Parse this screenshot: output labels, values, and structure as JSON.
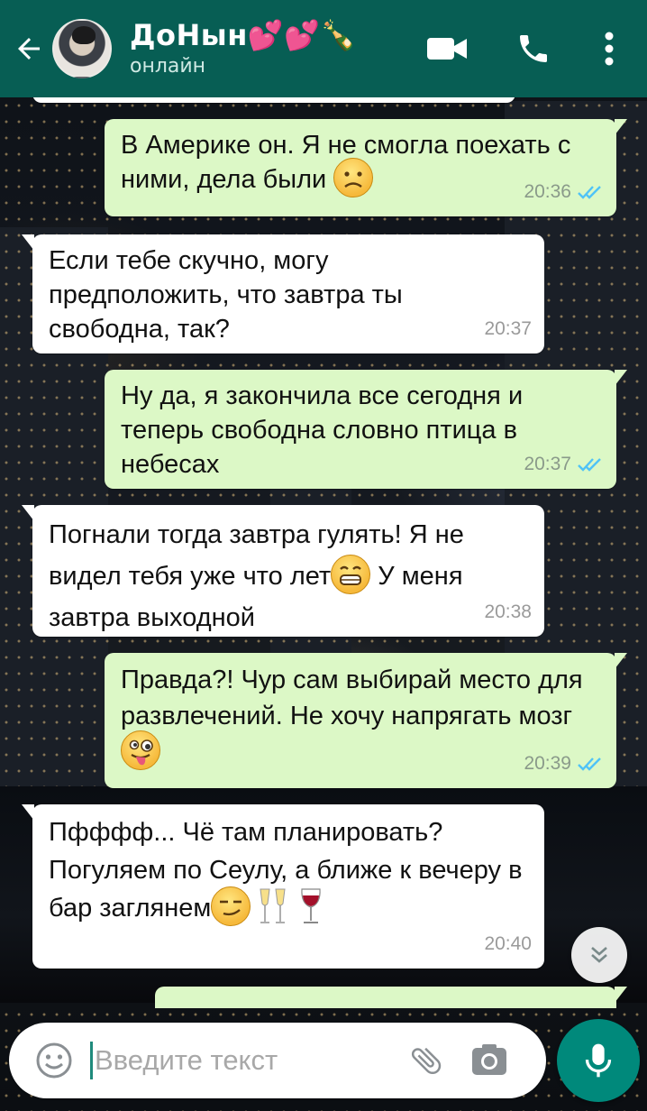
{
  "header": {
    "contact_name": "ДоНын💕💕🍾",
    "status": "онлайн",
    "colors": {
      "bar": "#075e54"
    }
  },
  "messages": [
    {
      "direction": "out",
      "text": "В Америке он. Я не смогла поехать с ними, дела были",
      "emoji": "frowning-face",
      "time": "20:36",
      "ticks": "read"
    },
    {
      "direction": "in",
      "text": "Если тебе скучно, могу предположить, что завтра ты свободна, так?",
      "time": "20:37"
    },
    {
      "direction": "out",
      "text": "Ну да, я закончила все сегодня и теперь свободна словно птица в небесах",
      "time": "20:37",
      "ticks": "read"
    },
    {
      "direction": "in",
      "text_before": "Погнали тогда завтра гулять! Я не видел тебя уже что лет",
      "emoji": "grinning-face",
      "text_after": " У меня завтра выходной",
      "time": "20:38"
    },
    {
      "direction": "out",
      "text": "Правда?! Чур сам выбирай место для развлечений. Не хочу напрягать мозг",
      "emoji": "winking-tongue-face",
      "time": "20:39",
      "ticks": "read"
    },
    {
      "direction": "in",
      "text": "Пфффф... Чё там планировать? Погуляем по Сеулу, а ближе к вечеру в бар заглянем",
      "emoji": "smirking-face, champagne-glasses, wine-glass",
      "time": "20:40"
    }
  ],
  "composer": {
    "placeholder": "Введите текст"
  },
  "colors": {
    "outgoing_bubble": "#dcf8c6",
    "incoming_bubble": "#ffffff",
    "read_ticks": "#4fc3f7",
    "mic_button": "#00897b"
  }
}
